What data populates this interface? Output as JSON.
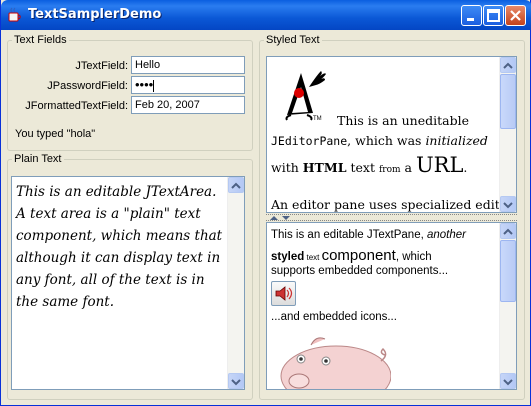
{
  "window": {
    "title": "TextSamplerDemo",
    "minimize_icon": "minimize-icon",
    "maximize_icon": "maximize-icon",
    "close_icon": "close-icon"
  },
  "text_fields": {
    "legend": "Text Fields",
    "jtextfield_label": "JTextField:",
    "jtextfield_value": "Hello",
    "jpasswordfield_label": "JPasswordField:",
    "jpasswordfield_value": "••••",
    "jformatted_label": "JFormattedTextField:",
    "jformatted_value": "Feb 20, 2007",
    "status": "You typed \"hola\""
  },
  "plain_text": {
    "legend": "Plain Text",
    "body": "This is an editable JTextArea. A text area is a \"plain\" text component, which means that although it can display text in any font, all of the text is in the same font."
  },
  "styled_text": {
    "legend": "Styled Text",
    "editor": {
      "line1": "This is an uneditable",
      "line2_code": "JEditorPane",
      "line2_a": ", which was ",
      "line2_italic": "initialized",
      "line3_with": "with ",
      "line3_html": "HTML",
      "line3_text": " text ",
      "line3_from": "from",
      "line3_a": " a ",
      "line3_url": "URL",
      "line3_dot": ".",
      "line4": "An editor pane uses specialized editor"
    },
    "pane": {
      "line1_a": "This is an editable JTextPane, ",
      "line1_italic": "another",
      "line2_bold": "styled",
      "line2_small": " text ",
      "line2_big": "component",
      "line2_rest": ", which",
      "line3": "supports embedded components...",
      "line4": "...and embedded icons..."
    }
  }
}
